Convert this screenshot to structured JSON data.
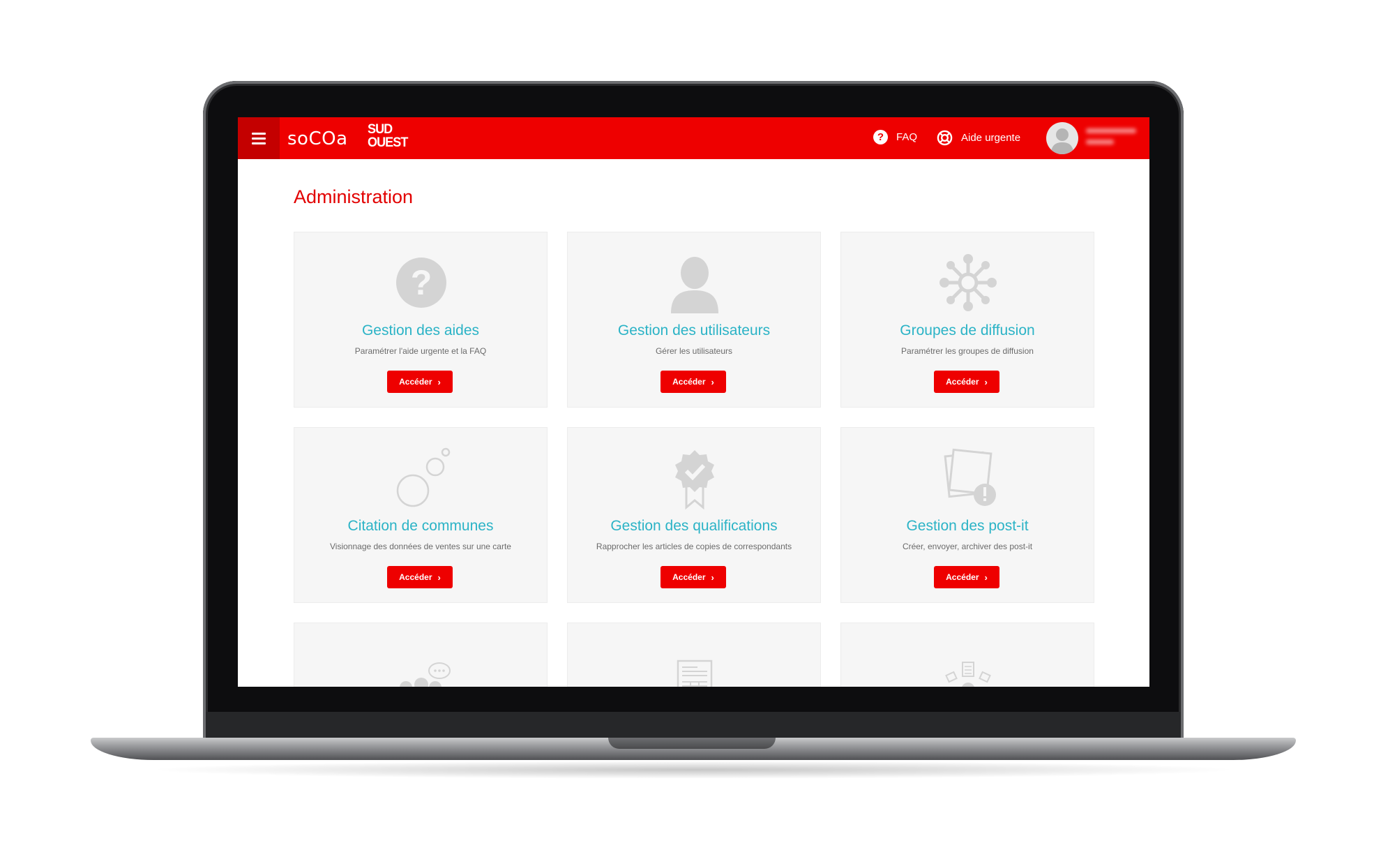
{
  "topbar": {
    "brand_primary": "soCOa",
    "brand_secondary_line1": "SUD",
    "brand_secondary_line2": "OUEST",
    "faq_label": "FAQ",
    "urgent_help_label": "Aide urgente",
    "accent_color": "#ee0000"
  },
  "page": {
    "title": "Administration"
  },
  "cards": [
    {
      "icon": "question-circle-icon",
      "title": "Gestion des aides",
      "description": "Paramétrer l'aide urgente et la FAQ",
      "button_label": "Accéder"
    },
    {
      "icon": "user-icon",
      "title": "Gestion des utilisateurs",
      "description": "Gérer les utilisateurs",
      "button_label": "Accéder"
    },
    {
      "icon": "network-icon",
      "title": "Groupes de diffusion",
      "description": "Paramétrer les groupes de diffusion",
      "button_label": "Accéder"
    },
    {
      "icon": "bubbles-icon",
      "title": "Citation de communes",
      "description": "Visionnage des données de ventes sur une carte",
      "button_label": "Accéder"
    },
    {
      "icon": "certified-badge-icon",
      "title": "Gestion des qualifications",
      "description": "Rapprocher les articles de copies de correspondants",
      "button_label": "Accéder"
    },
    {
      "icon": "post-it-icon",
      "title": "Gestion des post-it",
      "description": "Créer, envoyer, archiver des post-it",
      "button_label": "Accéder"
    },
    {
      "icon": "group-chat-icon"
    },
    {
      "icon": "document-table-icon"
    },
    {
      "icon": "person-documents-icon"
    }
  ]
}
